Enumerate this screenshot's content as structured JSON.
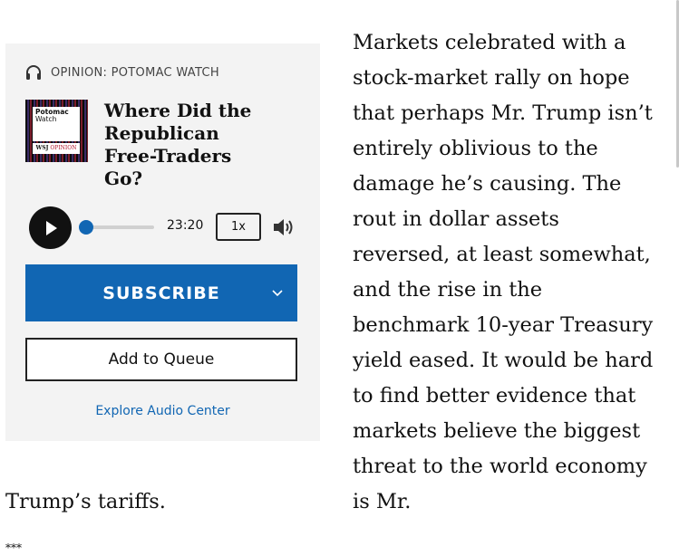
{
  "audio_card": {
    "kicker": "OPINION: POTOMAC WATCH",
    "artwork": {
      "line1": "Potomac",
      "line2": "Watch",
      "brand": "WSJ",
      "brand_accent": "OPINION"
    },
    "episode_title": "Where Did the Republican Free-Traders Go?",
    "player": {
      "time": "23:20",
      "speed": "1x",
      "progress_fraction": 0.0
    },
    "subscribe_label": "SUBSCRIBE",
    "queue_label": "Add to Queue",
    "explore_label": "Explore Audio Center"
  },
  "article": {
    "paragraph_right": "Markets celebrated with a stock-market rally on hope that perhaps Mr. Trump isn’t entirely oblivious to the damage he’s causing. The rout in dollar assets reversed, at least somewhat, and the rise in the benchmark 10-year Treasury yield eased. It would be hard to find better evidence that markets believe the biggest threat to the world economy is Mr.",
    "paragraph_continued": "Trump’s tariffs.",
    "separator": "***"
  },
  "colors": {
    "accent": "#1166b3",
    "card_bg": "#f3f3f3",
    "text": "#111111"
  },
  "icons": [
    "headphones-icon",
    "play-icon",
    "volume-icon",
    "chevron-down-icon"
  ]
}
